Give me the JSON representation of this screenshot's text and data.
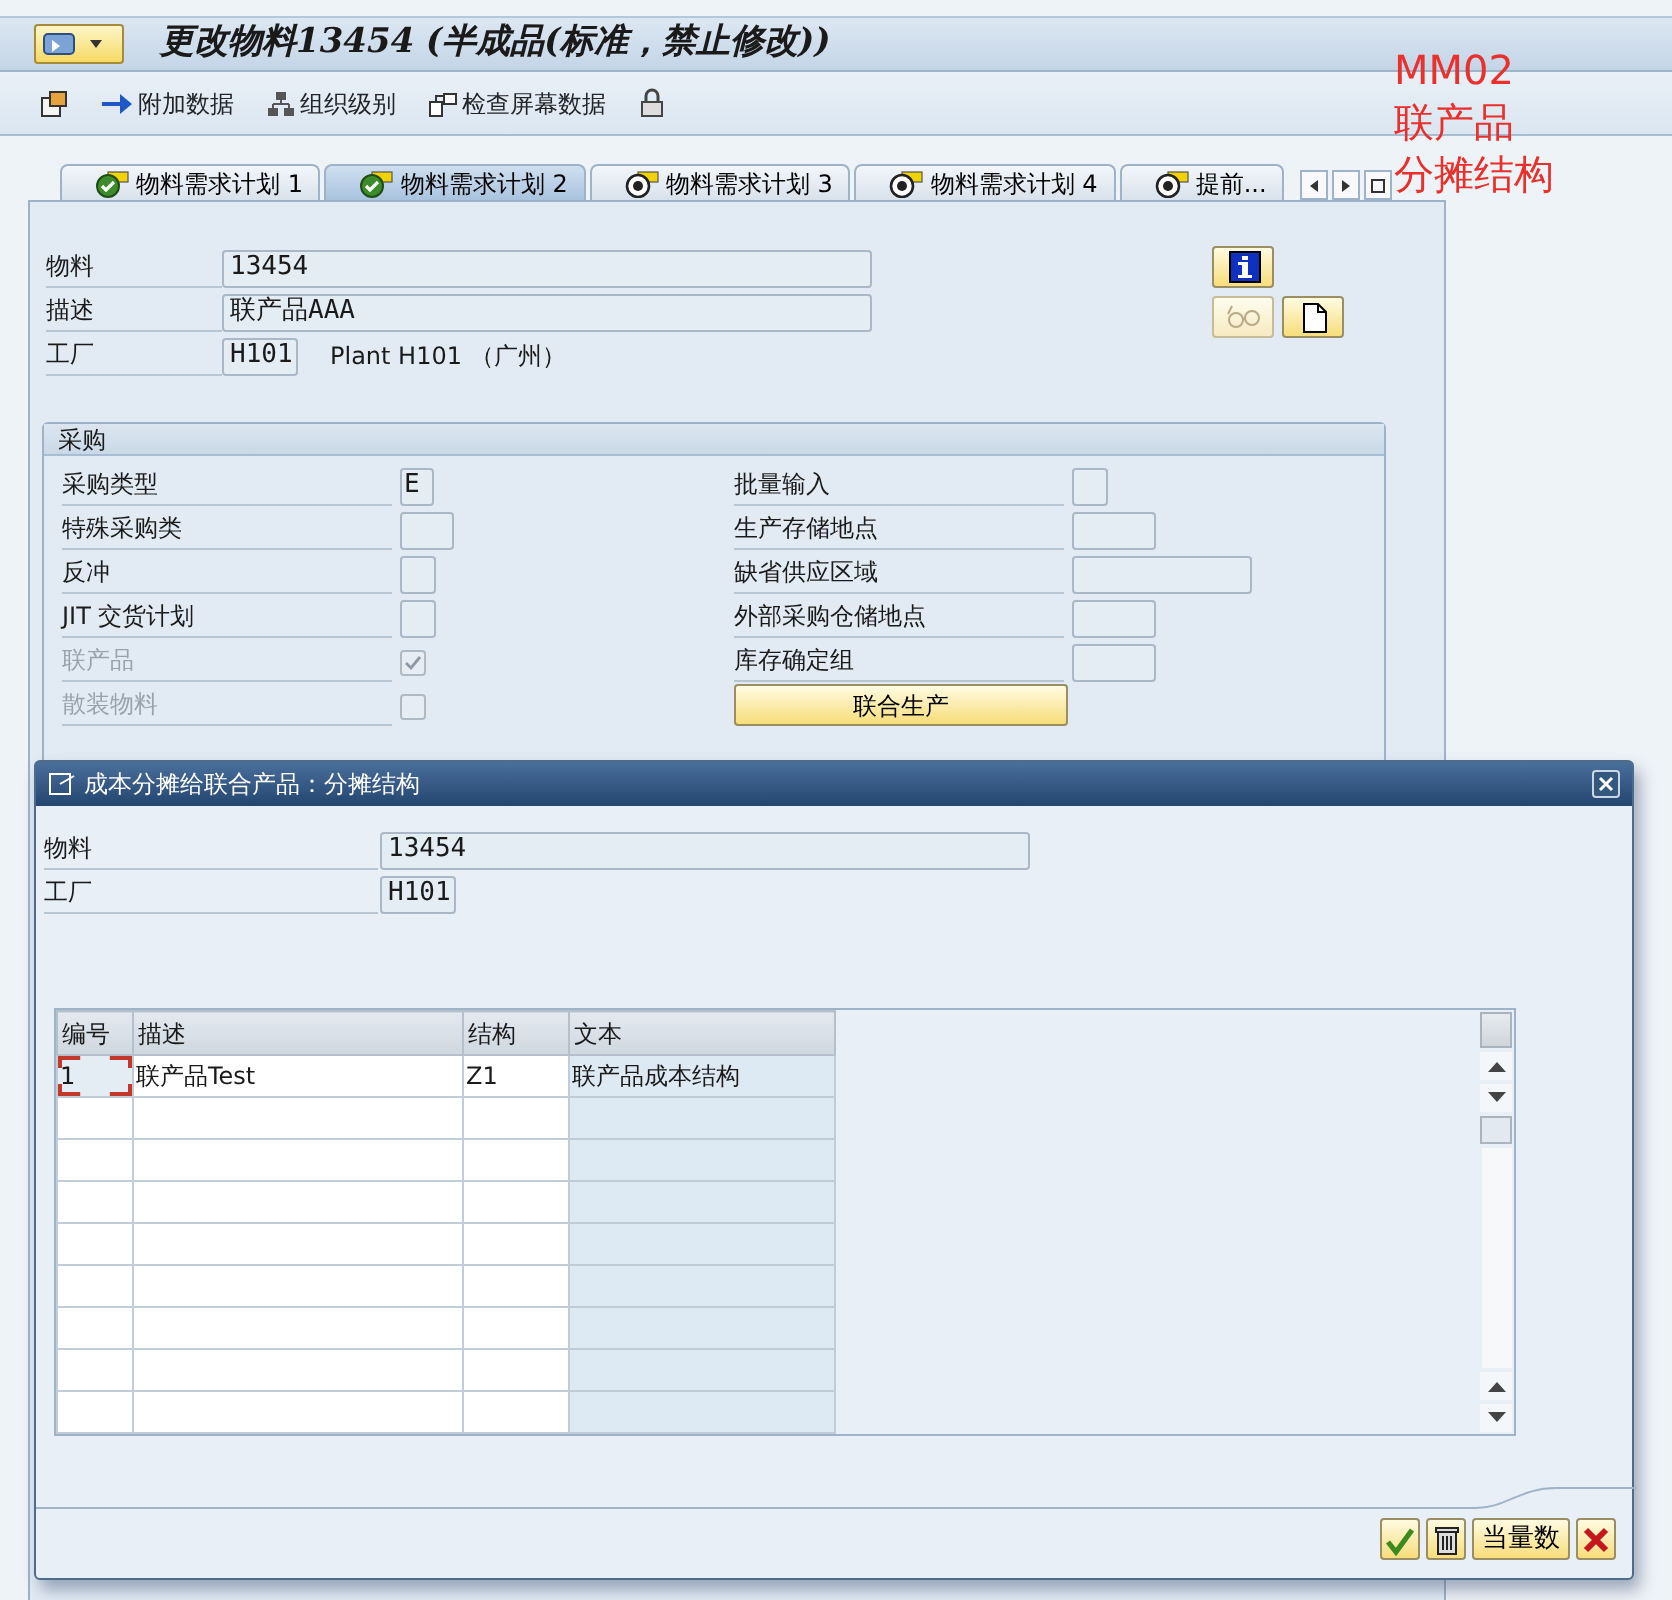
{
  "title_bar": {
    "title": "更改物料13454 (半成品(标准，禁止修改))"
  },
  "toolbar": [
    {
      "kind": "toggle"
    },
    {
      "kind": "arrow",
      "label": "附加数据"
    },
    {
      "kind": "org",
      "label": "组织级别"
    },
    {
      "kind": "check",
      "label": "检查屏幕数据"
    },
    {
      "kind": "lock"
    }
  ],
  "annotation": {
    "lines": [
      "MM02",
      "联产品",
      "分摊结构"
    ]
  },
  "tabs": [
    {
      "label": "物料需求计划 1",
      "selected": false,
      "complete": true
    },
    {
      "label": "物料需求计划 2",
      "selected": true,
      "complete": true
    },
    {
      "label": "物料需求计划 3",
      "selected": false,
      "complete": false
    },
    {
      "label": "物料需求计划 4",
      "selected": false,
      "complete": false
    },
    {
      "label": "提前...",
      "selected": false,
      "complete": false
    }
  ],
  "header_fields": [
    {
      "label": "物料",
      "value": "13454",
      "kind": "long"
    },
    {
      "label": "描述",
      "value": "联产品AAA",
      "kind": "long"
    },
    {
      "label": "工厂",
      "value": "H101",
      "kind": "short",
      "description": "Plant H101 （广州）"
    }
  ],
  "header_buttons": [
    {
      "kind": "info",
      "disabled": false
    },
    {
      "kind": "glasses",
      "disabled": true
    },
    {
      "kind": "document",
      "disabled": false
    }
  ],
  "purchasing": {
    "title": "采购",
    "left": [
      {
        "label": "采购类型",
        "kind": "field",
        "value": "E",
        "disabled": false
      },
      {
        "label": "特殊采购类",
        "kind": "field",
        "disabled": false
      },
      {
        "label": "反冲",
        "kind": "field",
        "disabled": false
      },
      {
        "label": "JIT 交货计划",
        "kind": "field",
        "disabled": false
      },
      {
        "label": "联产品",
        "kind": "checkbox",
        "checked": true,
        "disabled": true
      },
      {
        "label": "散装物料",
        "kind": "checkbox",
        "checked": false,
        "disabled": true
      }
    ],
    "right": [
      {
        "label": "批量输入",
        "kind": "field",
        "disabled": false
      },
      {
        "label": "生产存储地点",
        "kind": "field",
        "disabled": false
      },
      {
        "label": "缺省供应区域",
        "kind": "field",
        "disabled": false
      },
      {
        "label": "外部采购仓储地点",
        "kind": "field",
        "disabled": false
      },
      {
        "label": "库存确定组",
        "kind": "field",
        "disabled": false
      }
    ],
    "button": "联合生产"
  },
  "dialog": {
    "title": "成本分摊给联合产品：分摊结构",
    "fields": [
      {
        "label": "物料",
        "value": "13454",
        "kind": "long"
      },
      {
        "label": "工厂",
        "value": "H101",
        "kind": "short"
      }
    ],
    "table": {
      "columns": [
        {
          "label": "编号",
          "readonly": false
        },
        {
          "label": "描述",
          "readonly": false
        },
        {
          "label": "结构",
          "readonly": false
        },
        {
          "label": "文本",
          "readonly": true
        }
      ],
      "rows": [
        {
          "cells": [
            "1",
            "联产品Test",
            "Z1",
            "联产品成本结构"
          ],
          "cursor": true
        }
      ]
    },
    "buttons": [
      {
        "kind": "confirm"
      },
      {
        "kind": "delete"
      },
      {
        "kind": "text",
        "label": "当量数"
      },
      {
        "kind": "cancel"
      }
    ]
  }
}
